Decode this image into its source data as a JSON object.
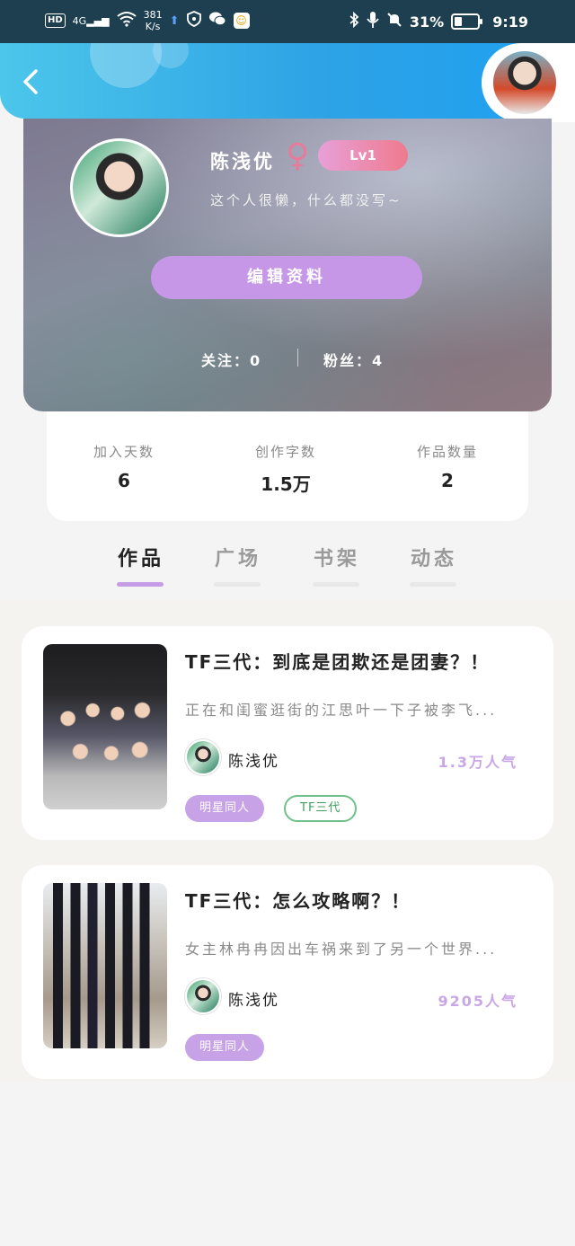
{
  "status_bar": {
    "hd": "HD",
    "signal": "4G",
    "net_speed_value": "381",
    "net_speed_unit": "K/s",
    "battery": "31%",
    "time": "9:19"
  },
  "profile": {
    "name": "陈浅优",
    "gender_symbol": "♀",
    "level": "Lv1",
    "bio": "这个人很懒，什么都没写~",
    "edit_button": "编辑资料",
    "following": "关注：0",
    "followers": "粉丝：4"
  },
  "stats": [
    {
      "label": "加入天数",
      "value": "6"
    },
    {
      "label": "创作字数",
      "value": "1.5万"
    },
    {
      "label": "作品数量",
      "value": "2"
    }
  ],
  "tabs": [
    {
      "label": "作品",
      "active": true
    },
    {
      "label": "广场",
      "active": false
    },
    {
      "label": "书架",
      "active": false
    },
    {
      "label": "动态",
      "active": false
    }
  ],
  "works": [
    {
      "title": "TF三代：到底是团欺还是团妻？！",
      "desc": "正在和闺蜜逛街的江思叶一下子被李飞...",
      "author": "陈浅优",
      "popularity": "1.3万人气",
      "tags": [
        "明星同人",
        "TF三代"
      ]
    },
    {
      "title": "TF三代：怎么攻略啊？！",
      "desc": "女主林冉冉因出车祸来到了另一个世界...",
      "author": "陈浅优",
      "popularity": "9205人气",
      "tags": [
        "明星同人"
      ]
    }
  ],
  "colors": {
    "accent_purple": "#c597e6",
    "header_blue": "#2ea3e6",
    "tag_green": "#6fc08a"
  }
}
